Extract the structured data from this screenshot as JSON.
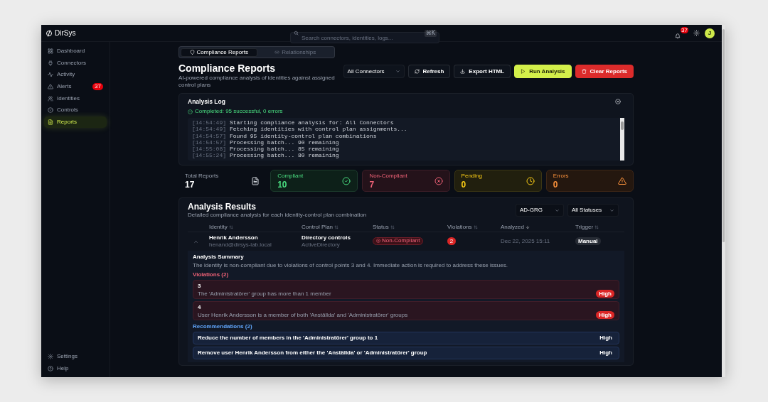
{
  "app": {
    "logo": "DirSys"
  },
  "topbar": {
    "search_placeholder": "Search connectors, identities, logs...",
    "shortcut": "⌘K",
    "notifications": "37",
    "avatar": "J"
  },
  "sidebar": {
    "items": [
      {
        "label": "Dashboard",
        "selected": false
      },
      {
        "label": "Connectors",
        "selected": false
      },
      {
        "label": "Activity",
        "selected": false
      },
      {
        "label": "Alerts",
        "selected": false,
        "badge": "37"
      },
      {
        "label": "Identities",
        "selected": false
      },
      {
        "label": "Controls",
        "selected": false
      },
      {
        "label": "Reports",
        "selected": true
      }
    ],
    "footer_items": [
      {
        "label": "Settings"
      },
      {
        "label": "Help"
      }
    ]
  },
  "tabs": [
    {
      "label": "Compliance Reports",
      "selected": true
    },
    {
      "label": "Relationships",
      "selected": false
    }
  ],
  "header": {
    "title": "Compliance Reports",
    "subtitle": "AI-powered compliance analysis of identities against assigned control plans"
  },
  "toolbar": {
    "connector_select": "All Connectors",
    "buttons": [
      {
        "label": "Refresh",
        "kind": "default"
      },
      {
        "label": "Export HTML",
        "kind": "default"
      },
      {
        "label": "Run Analysis",
        "kind": "primary"
      },
      {
        "label": "Clear Reports",
        "kind": "danger"
      }
    ]
  },
  "analysis_log": {
    "title": "Analysis Log",
    "status": "Completed: 95 successful, 0 errors",
    "lines": [
      {
        "time": "[14:54:49]",
        "message": "Starting compliance analysis for: All Connectors"
      },
      {
        "time": "[14:54:49]",
        "message": "Fetching identities with control plan assignments..."
      },
      {
        "time": "[14:54:57]",
        "message": "Found 95 identity-control plan combinations"
      },
      {
        "time": "[14:54:57]",
        "message": "Processing batch... 90 remaining"
      },
      {
        "time": "[14:55:08]",
        "message": "Processing batch... 85 remaining"
      },
      {
        "time": "[14:55:24]",
        "message": "Processing batch... 80 remaining"
      }
    ]
  },
  "stats": [
    {
      "label": "Total Reports",
      "value": "17",
      "kind": "neutral"
    },
    {
      "label": "Compliant",
      "value": "10",
      "kind": "success"
    },
    {
      "label": "Non-Compliant",
      "value": "7",
      "kind": "danger"
    },
    {
      "label": "Pending",
      "value": "0",
      "kind": "pending"
    },
    {
      "label": "Errors",
      "value": "0",
      "kind": "error"
    }
  ],
  "results": {
    "title": "Analysis Results",
    "subtitle": "Detailed compliance analysis for each identity-control plan combination",
    "filters": [
      "AD-GRG",
      "All Statuses"
    ],
    "columns": [
      {
        "label": "Identity",
        "sorted": false
      },
      {
        "label": "Control Plan",
        "sorted": false
      },
      {
        "label": "Status",
        "sorted": false
      },
      {
        "label": "Violations",
        "sorted": false
      },
      {
        "label": "Analyzed",
        "sorted": true
      },
      {
        "label": "Trigger",
        "sorted": false
      }
    ],
    "rows": [
      {
        "expanded": true,
        "identity": "Henrik Andersson",
        "email": "henand@dirsys-lab.local",
        "control_plan": "Directory controls",
        "source": "ActiveDirectory",
        "status": "Non-Compliant",
        "violations": "2",
        "analyzed": "Dec 22, 2025 15:11",
        "trigger": "Manual",
        "details": {
          "summary_title": "Analysis Summary",
          "summary": "The identity is non-compliant due to violations of control points 3 and 4. Immediate action is required to address these issues.",
          "violations_title": "Violations (2)",
          "violations": [
            {
              "id": "3",
              "text": "The 'Administratörer' group has more than 1 member",
              "severity": "High"
            },
            {
              "id": "4",
              "text": "User Henrik Andersson is a member of both 'Anställda' and 'Administratörer' groups",
              "severity": "High"
            }
          ],
          "recommendations_title": "Recommendations (2)",
          "recommendations": [
            {
              "text": "Reduce the number of members in the 'Administratörer' group to 1",
              "priority": "High"
            },
            {
              "text": "Remove user Henrik Andersson from either the 'Anställda' or 'Administratörer' group",
              "priority": "High"
            }
          ]
        }
      }
    ]
  }
}
